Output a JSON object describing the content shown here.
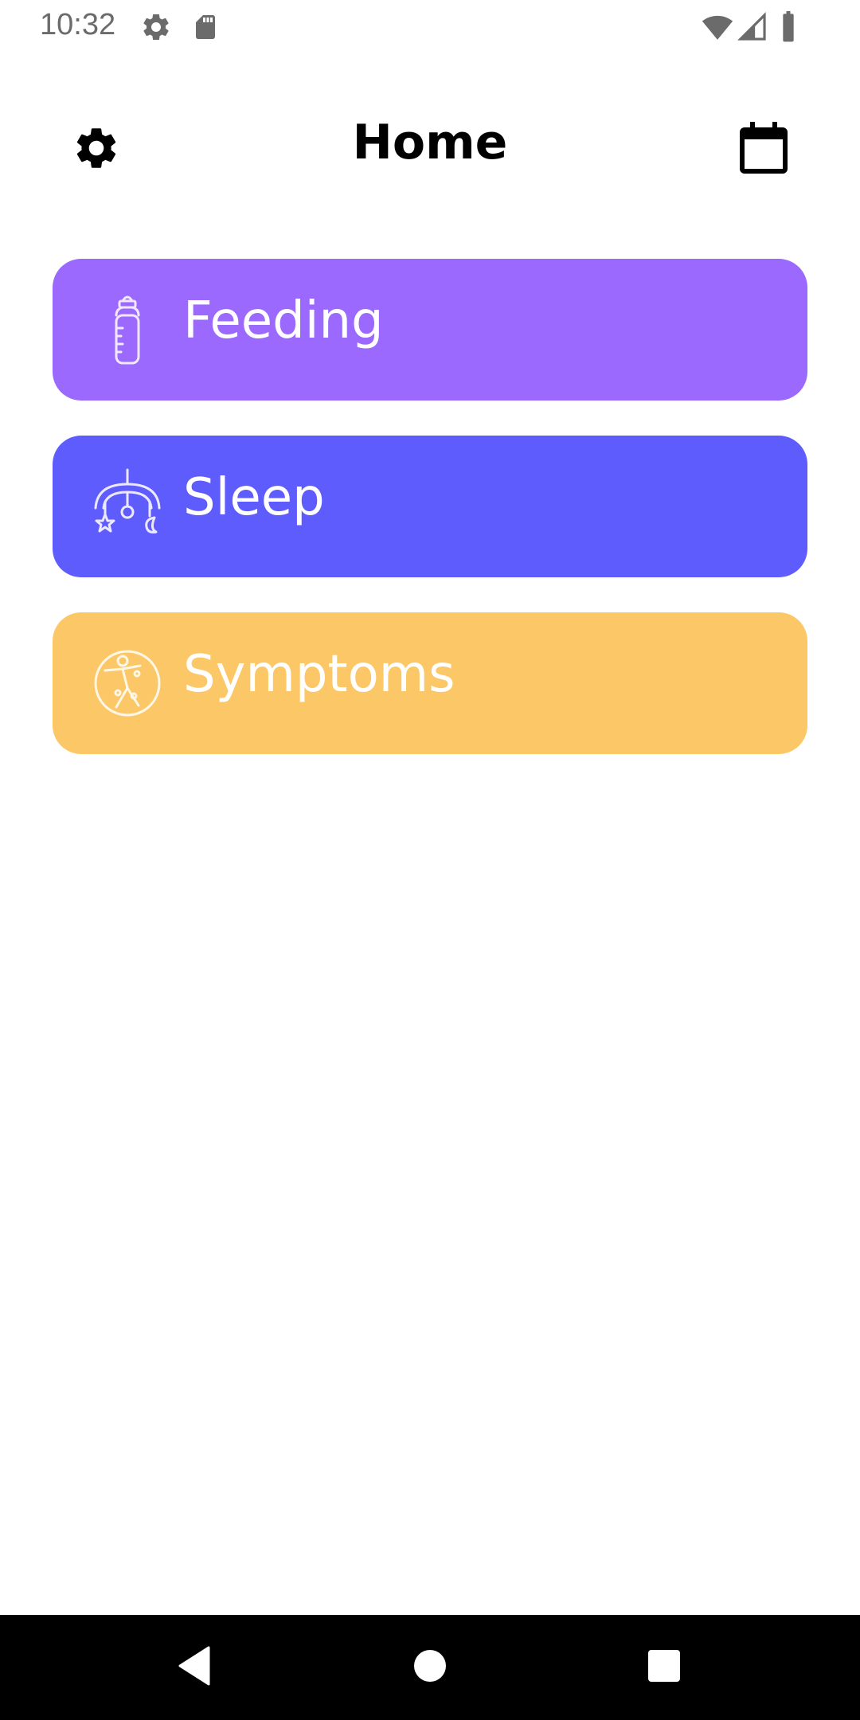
{
  "status_bar": {
    "time": "10:32",
    "icons": [
      "gear-icon",
      "sd-card-icon",
      "wifi-icon",
      "signal-icon",
      "battery-icon"
    ]
  },
  "header": {
    "title": "Home",
    "left_icon": "gear-icon",
    "right_icon": "calendar-icon"
  },
  "categories": [
    {
      "label": "Feeding",
      "icon": "baby-bottle-icon",
      "color": "#9c69fe"
    },
    {
      "label": "Sleep",
      "icon": "crib-mobile-icon",
      "color": "#5f5cfd"
    },
    {
      "label": "Symptoms",
      "icon": "body-symptoms-icon",
      "color": "#fcc766"
    }
  ],
  "nav_bar": {
    "buttons": [
      "back-icon",
      "home-icon",
      "recents-icon"
    ]
  }
}
